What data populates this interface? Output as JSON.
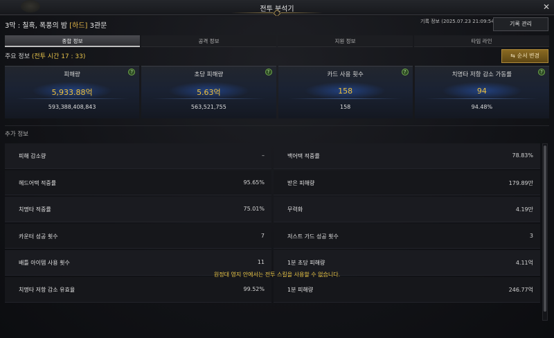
{
  "window": {
    "title": "전투 분석기",
    "close_glyph": "✕"
  },
  "header": {
    "stage_prefix": "3막 : 칠흑, 폭풍의 밤 ",
    "difficulty": "[하드]",
    "stage_suffix": " 3관문",
    "record_info": "기록 정보 (2025.07.23 21:09:54)",
    "record_button": "기록 관리"
  },
  "tabs": [
    {
      "label": "종합 정보",
      "active": true
    },
    {
      "label": "공격 정보",
      "active": false
    },
    {
      "label": "지원 정보",
      "active": false
    },
    {
      "label": "타임 라인",
      "active": false
    }
  ],
  "main": {
    "label": "주요 정보 ",
    "battle_time": "(전투 시간 17 : 33)",
    "order_button": "순서 변경",
    "order_icon": "⇆"
  },
  "cards": [
    {
      "title": "피해량",
      "big": "5,933.88억",
      "small": "593,388,408,843"
    },
    {
      "title": "초당 피해량",
      "big": "5.63억",
      "small": "563,521,755"
    },
    {
      "title": "카드 사용 횟수",
      "big": "158",
      "small": "158"
    },
    {
      "title": "치명타 저항 감소 가동률",
      "big": "94",
      "small": "94.48%"
    }
  ],
  "help_glyph": "?",
  "extra": {
    "label": "추가 정보",
    "rows": [
      {
        "k": "피해 감소량",
        "v": "–"
      },
      {
        "k": "백어택 적중률",
        "v": "78.83%"
      },
      {
        "k": "헤드어택 적중률",
        "v": "95.65%"
      },
      {
        "k": "받은 피해량",
        "v": "179.89만"
      },
      {
        "k": "치명타 적중률",
        "v": "75.01%"
      },
      {
        "k": "무력화",
        "v": "4.19만"
      },
      {
        "k": "카운터 성공 횟수",
        "v": "7"
      },
      {
        "k": "저스트 가드 성공 횟수",
        "v": "3"
      },
      {
        "k": "배틀 아이템 사용 횟수",
        "v": "11"
      },
      {
        "k": "1분 초당 피해량",
        "v": "4.11억"
      },
      {
        "k": "치명타 저항 감소 유효율",
        "v": "99.52%"
      },
      {
        "k": "1분 피해량",
        "v": "246.77억"
      }
    ]
  },
  "notice": "원정대 영지 안에서는 전투 스킬을 사용할 수 없습니다."
}
